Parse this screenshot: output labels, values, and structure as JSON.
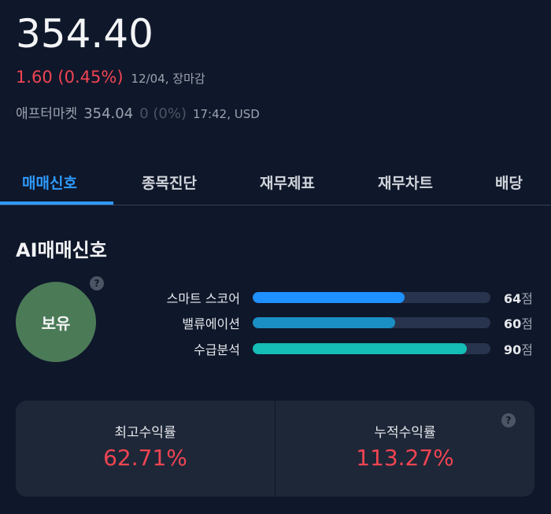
{
  "quote": {
    "price": "354.40",
    "change": "1.60 (0.45%)",
    "date_status": "12/04, 장마감",
    "after_label": "애프터마켓",
    "after_price": "354.04",
    "after_change": "0 (0%)",
    "after_time": "17:42, USD"
  },
  "tabs": [
    {
      "label": "매매신호",
      "active": true
    },
    {
      "label": "종목진단",
      "active": false
    },
    {
      "label": "재무제표",
      "active": false
    },
    {
      "label": "재무차트",
      "active": false
    },
    {
      "label": "배당",
      "active": false
    }
  ],
  "signal": {
    "title": "AI매매신호",
    "recommendation": "보유",
    "help_icon": "?",
    "scores": [
      {
        "label": "스마트 스코어",
        "value": 64,
        "value_text": "64",
        "unit": "점",
        "color": "#1e90ff"
      },
      {
        "label": "밸류에이션",
        "value": 60,
        "value_text": "60",
        "unit": "점",
        "color": "#1a8fc4"
      },
      {
        "label": "수급분석",
        "value": 90,
        "value_text": "90",
        "unit": "점",
        "color": "#14bdb5"
      }
    ]
  },
  "returns": {
    "help_icon": "?",
    "max": {
      "label": "최고수익률",
      "value": "62.71%"
    },
    "cumulative": {
      "label": "누적수익률",
      "value": "113.27%"
    }
  },
  "colors": {
    "accent": "#2e9bff",
    "negative": "#f04452",
    "hold": "#4b7a57"
  }
}
